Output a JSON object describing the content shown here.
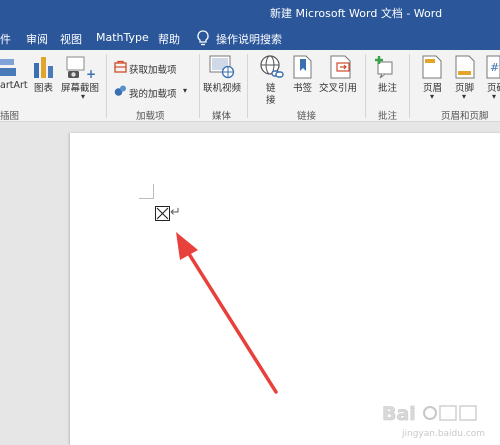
{
  "title": {
    "text": "新建 Microsoft Word 文档 - Word"
  },
  "menu": {
    "items": [
      "件",
      "审阅",
      "视图",
      "MathType",
      "帮助"
    ],
    "tell_me": "操作说明搜索"
  },
  "ribbon": {
    "illustrations": {
      "smartart": "artArt",
      "chart": "图表",
      "screenshot": "屏幕截图",
      "screenshot_arrow": "▾",
      "group": "插图"
    },
    "addins": {
      "get": "获取加载项",
      "my": "我的加载项",
      "my_arrow": "▾",
      "group": "加载项"
    },
    "media": {
      "online_video": "联机视频",
      "group": "媒体"
    },
    "links": {
      "link_line1": "链",
      "link_line2": "接",
      "bookmark": "书签",
      "cross_ref": "交叉引用",
      "group": "链接"
    },
    "comments": {
      "comment": "批注",
      "group": "批注"
    },
    "header_footer": {
      "header": "页眉",
      "footer": "页脚",
      "page_num": "页码",
      "arrow": "▾",
      "group": "页眉和页脚"
    }
  },
  "document": {
    "return_mark": "↵"
  },
  "colors": {
    "brand": "#2b579a",
    "arrow": "#e8403a"
  }
}
